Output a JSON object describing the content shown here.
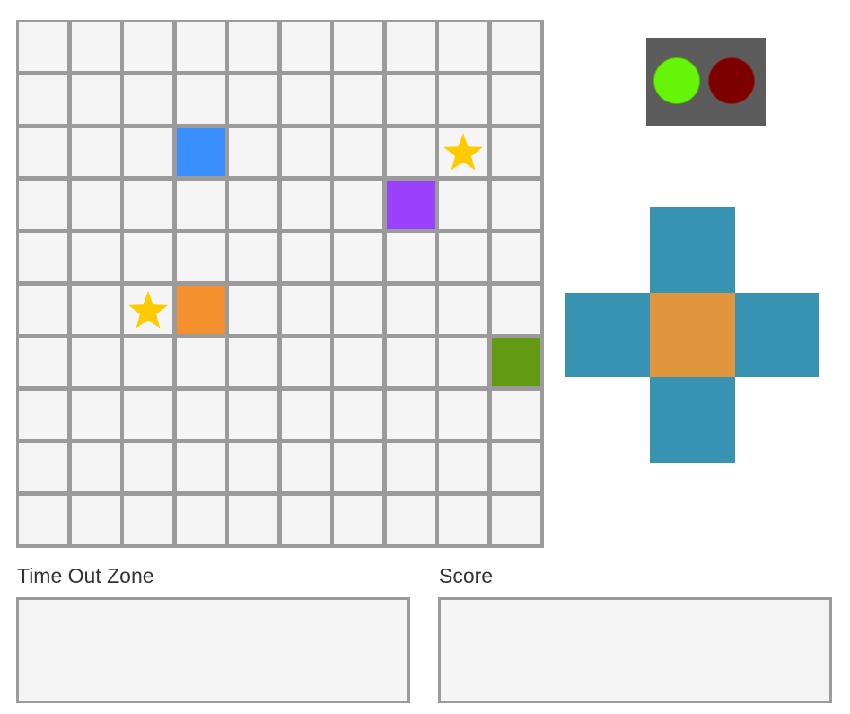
{
  "board": {
    "rows": 10,
    "cols": 10,
    "cell_color": "#f5f5f5",
    "line_color": "#9b9b9b",
    "pieces": [
      {
        "name": "blue-piece",
        "row": 2,
        "col": 3,
        "color": "#3a8efd"
      },
      {
        "name": "purple-piece",
        "row": 3,
        "col": 7,
        "color": "#9b40fd"
      },
      {
        "name": "orange-piece",
        "row": 5,
        "col": 3,
        "color": "#f5902e"
      },
      {
        "name": "green-piece",
        "row": 6,
        "col": 9,
        "color": "#649a11"
      }
    ],
    "stars": [
      {
        "row": 2,
        "col": 8,
        "color": "#fecb00"
      },
      {
        "row": 5,
        "col": 2,
        "color": "#fecb00"
      }
    ]
  },
  "traffic_light": {
    "box_color": "#5c5c5c",
    "go_color": "#66f508",
    "stop_color": "#7d0000",
    "active": "go"
  },
  "dpad": {
    "arm_color": "#3793b1",
    "center_color": "#e1953c"
  },
  "zones": {
    "timeout_label": "Time Out Zone",
    "score_label": "Score"
  }
}
